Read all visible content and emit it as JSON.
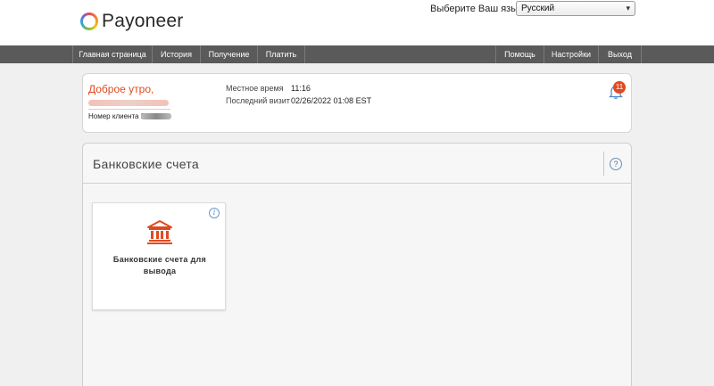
{
  "brand": {
    "name": "Payoneer"
  },
  "language": {
    "label": "Выберите Ваш язык:",
    "selected": "Русский"
  },
  "nav": {
    "left": [
      "Главная страница",
      "История",
      "Получение",
      "Платить"
    ],
    "right": [
      "Помощь",
      "Настройки",
      "Выход"
    ]
  },
  "welcome": {
    "greeting": "Доброе утро,",
    "client_label": "Номер клиента 2",
    "local_time_label": "Местное время",
    "local_time_value": "11:16",
    "last_visit_label": "Последний визит",
    "last_visit_value": "02/26/2022 01:08 EST",
    "notifications_count": "11"
  },
  "accounts": {
    "title": "Банковские счета",
    "help_symbol": "?",
    "card": {
      "label": "Банковские счета для вывода",
      "info_symbol": "i"
    }
  },
  "colors": {
    "accent": "#e04a20",
    "navbar": "#5a5a5a",
    "link": "#4a86c5"
  }
}
